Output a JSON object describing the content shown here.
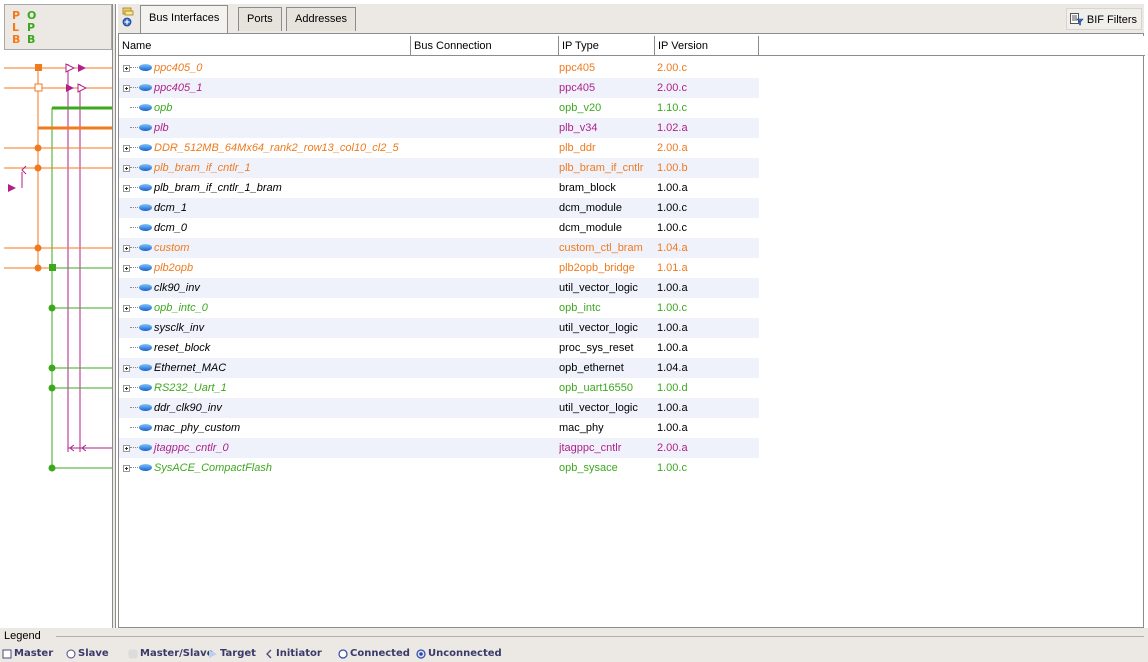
{
  "bus_panel": {
    "letters": [
      {
        "char": "P",
        "color": "#f07a1c"
      },
      {
        "char": "O",
        "color": "#3ca81e"
      },
      {
        "char": "L",
        "color": "#f07a1c"
      },
      {
        "char": "P",
        "color": "#3ca81e"
      },
      {
        "char": "B",
        "color": "#f07a1c"
      },
      {
        "char": "B",
        "color": "#3ca81e"
      }
    ]
  },
  "tabs": [
    {
      "label": "Bus Interfaces",
      "active": true
    },
    {
      "label": "Ports",
      "active": false
    },
    {
      "label": "Addresses",
      "active": false
    }
  ],
  "toolbar": {
    "bif_filters_label": "BIF Filters"
  },
  "table": {
    "columns": [
      "Name",
      "Bus Connection",
      "IP Type",
      "IP Version"
    ],
    "rows": [
      {
        "name": "ppc405_0",
        "ip_type": "ppc405",
        "ip_version": "2.00.c",
        "color": "orange",
        "expandable": true
      },
      {
        "name": "ppc405_1",
        "ip_type": "ppc405",
        "ip_version": "2.00.c",
        "color": "magenta",
        "expandable": true
      },
      {
        "name": "opb",
        "ip_type": "opb_v20",
        "ip_version": "1.10.c",
        "color": "green",
        "expandable": false
      },
      {
        "name": "plb",
        "ip_type": "plb_v34",
        "ip_version": "1.02.a",
        "color": "magenta",
        "expandable": false
      },
      {
        "name": "DDR_512MB_64Mx64_rank2_row13_col10_cl2_5",
        "ip_type": "plb_ddr",
        "ip_version": "2.00.a",
        "color": "orange",
        "expandable": true
      },
      {
        "name": "plb_bram_if_cntlr_1",
        "ip_type": "plb_bram_if_cntlr",
        "ip_version": "1.00.b",
        "color": "orange",
        "expandable": true
      },
      {
        "name": "plb_bram_if_cntlr_1_bram",
        "ip_type": "bram_block",
        "ip_version": "1.00.a",
        "color": "black",
        "expandable": true
      },
      {
        "name": "dcm_1",
        "ip_type": "dcm_module",
        "ip_version": "1.00.c",
        "color": "black",
        "expandable": false
      },
      {
        "name": "dcm_0",
        "ip_type": "dcm_module",
        "ip_version": "1.00.c",
        "color": "black",
        "expandable": false
      },
      {
        "name": "custom",
        "ip_type": "custom_ctl_bram",
        "ip_version": "1.04.a",
        "color": "orange",
        "expandable": true
      },
      {
        "name": "plb2opb",
        "ip_type": "plb2opb_bridge",
        "ip_version": "1.01.a",
        "color": "orange",
        "expandable": true
      },
      {
        "name": "clk90_inv",
        "ip_type": "util_vector_logic",
        "ip_version": "1.00.a",
        "color": "black",
        "expandable": false
      },
      {
        "name": "opb_intc_0",
        "ip_type": "opb_intc",
        "ip_version": "1.00.c",
        "color": "green",
        "expandable": true
      },
      {
        "name": "sysclk_inv",
        "ip_type": "util_vector_logic",
        "ip_version": "1.00.a",
        "color": "black",
        "expandable": false
      },
      {
        "name": "reset_block",
        "ip_type": "proc_sys_reset",
        "ip_version": "1.00.a",
        "color": "black",
        "expandable": false
      },
      {
        "name": "Ethernet_MAC",
        "ip_type": "opb_ethernet",
        "ip_version": "1.04.a",
        "color": "black",
        "expandable": true
      },
      {
        "name": "RS232_Uart_1",
        "ip_type": "opb_uart16550",
        "ip_version": "1.00.d",
        "color": "green",
        "expandable": true
      },
      {
        "name": "ddr_clk90_inv",
        "ip_type": "util_vector_logic",
        "ip_version": "1.00.a",
        "color": "black",
        "expandable": false
      },
      {
        "name": "mac_phy_custom",
        "ip_type": "mac_phy",
        "ip_version": "1.00.a",
        "color": "black",
        "expandable": false
      },
      {
        "name": "jtagppc_cntlr_0",
        "ip_type": "jtagppc_cntlr",
        "ip_version": "2.00.a",
        "color": "magenta",
        "expandable": true
      },
      {
        "name": "SysACE_CompactFlash",
        "ip_type": "opb_sysace",
        "ip_version": "1.00.c",
        "color": "green",
        "expandable": true
      }
    ]
  },
  "legend": {
    "title": "Legend",
    "items": [
      {
        "label": "Master",
        "icon": "master-square-icon"
      },
      {
        "label": "Slave",
        "icon": "slave-circle-icon"
      },
      {
        "label": "Master/Slave",
        "icon": "master-slave-icon"
      },
      {
        "label": "Target",
        "icon": "target-triangle-icon"
      },
      {
        "label": "Initiator",
        "icon": "initiator-chevron-icon"
      },
      {
        "label": "Connected",
        "icon": "connected-circle-icon"
      },
      {
        "label": "Unconnected",
        "icon": "unconnected-circle-icon"
      }
    ]
  },
  "colors": {
    "plb": "#f07a1c",
    "opb": "#3ca81e",
    "processor": "#b0208a",
    "row_alt": "#f0f2fb"
  }
}
